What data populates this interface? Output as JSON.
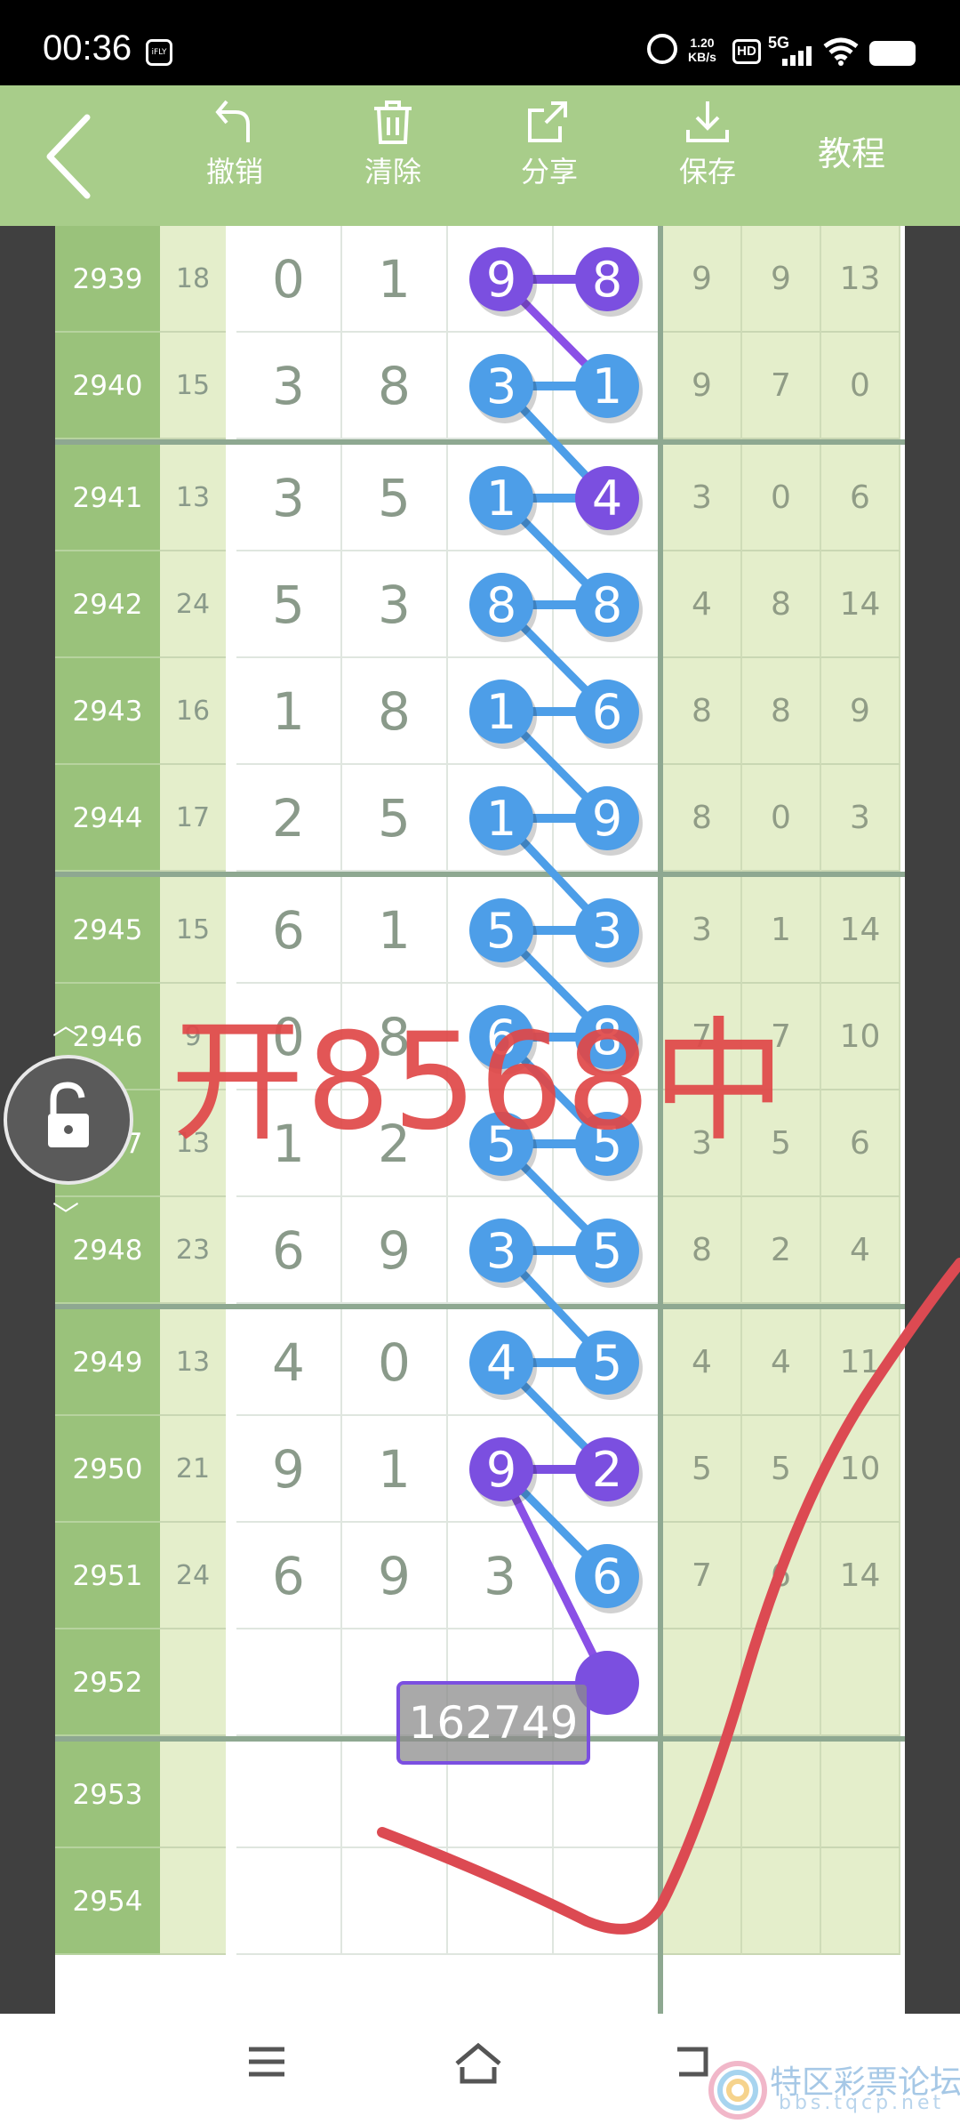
{
  "status_bar": {
    "time": "00:36",
    "app_icon_text": "iFLY",
    "speed_value": "1.20",
    "speed_unit": "KB/s",
    "hd": "HD",
    "network": "5G"
  },
  "toolbar": {
    "undo_label": "撤销",
    "clear_label": "清除",
    "share_label": "分享",
    "save_label": "保存",
    "tutorial_label": "教程"
  },
  "rows": [
    {
      "period": "2939",
      "sum": "18",
      "d1": "0",
      "d2": "1",
      "d3": "9",
      "d4": "8",
      "r1": "9",
      "r2": "9",
      "r3": "13"
    },
    {
      "period": "2940",
      "sum": "15",
      "d1": "3",
      "d2": "8",
      "d3": "3",
      "d4": "1",
      "r1": "9",
      "r2": "7",
      "r3": "0"
    },
    {
      "period": "2941",
      "sum": "13",
      "d1": "3",
      "d2": "5",
      "d3": "1",
      "d4": "4",
      "r1": "3",
      "r2": "0",
      "r3": "6"
    },
    {
      "period": "2942",
      "sum": "24",
      "d1": "5",
      "d2": "3",
      "d3": "8",
      "d4": "8",
      "r1": "4",
      "r2": "8",
      "r3": "14"
    },
    {
      "period": "2943",
      "sum": "16",
      "d1": "1",
      "d2": "8",
      "d3": "1",
      "d4": "6",
      "r1": "8",
      "r2": "8",
      "r3": "9"
    },
    {
      "period": "2944",
      "sum": "17",
      "d1": "2",
      "d2": "5",
      "d3": "1",
      "d4": "9",
      "r1": "8",
      "r2": "0",
      "r3": "3"
    },
    {
      "period": "2945",
      "sum": "15",
      "d1": "6",
      "d2": "1",
      "d3": "5",
      "d4": "3",
      "r1": "3",
      "r2": "1",
      "r3": "14"
    },
    {
      "period": "2946",
      "sum": "9",
      "d1": "0",
      "d2": "8",
      "d3": "6",
      "d4": "8",
      "r1": "7",
      "r2": "7",
      "r3": "10"
    },
    {
      "period": "2947",
      "sum": "13",
      "d1": "1",
      "d2": "2",
      "d3": "5",
      "d4": "5",
      "r1": "3",
      "r2": "5",
      "r3": "6"
    },
    {
      "period": "2948",
      "sum": "23",
      "d1": "6",
      "d2": "9",
      "d3": "3",
      "d4": "5",
      "r1": "8",
      "r2": "2",
      "r3": "4"
    },
    {
      "period": "2949",
      "sum": "13",
      "d1": "4",
      "d2": "0",
      "d3": "4",
      "d4": "5",
      "r1": "4",
      "r2": "4",
      "r3": "11"
    },
    {
      "period": "2950",
      "sum": "21",
      "d1": "9",
      "d2": "1",
      "d3": "9",
      "d4": "2",
      "r1": "5",
      "r2": "5",
      "r3": "10"
    },
    {
      "period": "2951",
      "sum": "24",
      "d1": "6",
      "d2": "9",
      "d3": "3",
      "d4": "6",
      "r1": "7",
      "r2": "6",
      "r3": "14"
    },
    {
      "period": "2952",
      "sum": "",
      "d1": "",
      "d2": "",
      "d3": "",
      "d4": "",
      "r1": "",
      "r2": "",
      "r3": ""
    },
    {
      "period": "2953",
      "sum": "",
      "d1": "",
      "d2": "",
      "d3": "",
      "d4": "",
      "r1": "",
      "r2": "",
      "r3": ""
    },
    {
      "period": "2954",
      "sum": "",
      "d1": "",
      "d2": "",
      "d3": "",
      "d4": "",
      "r1": "",
      "r2": "",
      "r3": ""
    }
  ],
  "ball_colors": {
    "purple": "#7b4fe0",
    "blue": "#4d9ee8",
    "line_purple": "#8a50e6",
    "line_blue": "#4d9ee8"
  },
  "highlights": [
    {
      "row": 0,
      "col": 2,
      "color": "purple"
    },
    {
      "row": 0,
      "col": 3,
      "color": "purple"
    },
    {
      "row": 1,
      "col": 2,
      "color": "blue"
    },
    {
      "row": 1,
      "col": 3,
      "color": "blue"
    },
    {
      "row": 2,
      "col": 2,
      "color": "blue"
    },
    {
      "row": 2,
      "col": 3,
      "color": "purple"
    },
    {
      "row": 3,
      "col": 2,
      "color": "blue"
    },
    {
      "row": 3,
      "col": 3,
      "color": "blue"
    },
    {
      "row": 4,
      "col": 2,
      "color": "blue"
    },
    {
      "row": 4,
      "col": 3,
      "color": "blue"
    },
    {
      "row": 5,
      "col": 2,
      "color": "blue"
    },
    {
      "row": 5,
      "col": 3,
      "color": "blue"
    },
    {
      "row": 6,
      "col": 2,
      "color": "blue"
    },
    {
      "row": 6,
      "col": 3,
      "color": "blue"
    },
    {
      "row": 7,
      "col": 2,
      "color": "blue"
    },
    {
      "row": 7,
      "col": 3,
      "color": "blue"
    },
    {
      "row": 8,
      "col": 2,
      "color": "blue"
    },
    {
      "row": 8,
      "col": 3,
      "color": "blue"
    },
    {
      "row": 9,
      "col": 2,
      "color": "blue"
    },
    {
      "row": 9,
      "col": 3,
      "color": "blue"
    },
    {
      "row": 10,
      "col": 2,
      "color": "blue"
    },
    {
      "row": 10,
      "col": 3,
      "color": "blue"
    },
    {
      "row": 11,
      "col": 2,
      "color": "purple"
    },
    {
      "row": 11,
      "col": 3,
      "color": "purple"
    },
    {
      "row": 12,
      "col": 3,
      "color": "blue"
    }
  ],
  "prediction": "162749",
  "annotation_text": "开8568中",
  "watermark": {
    "text": "特区彩票论坛",
    "sub": "bbs.tqcp.net"
  }
}
